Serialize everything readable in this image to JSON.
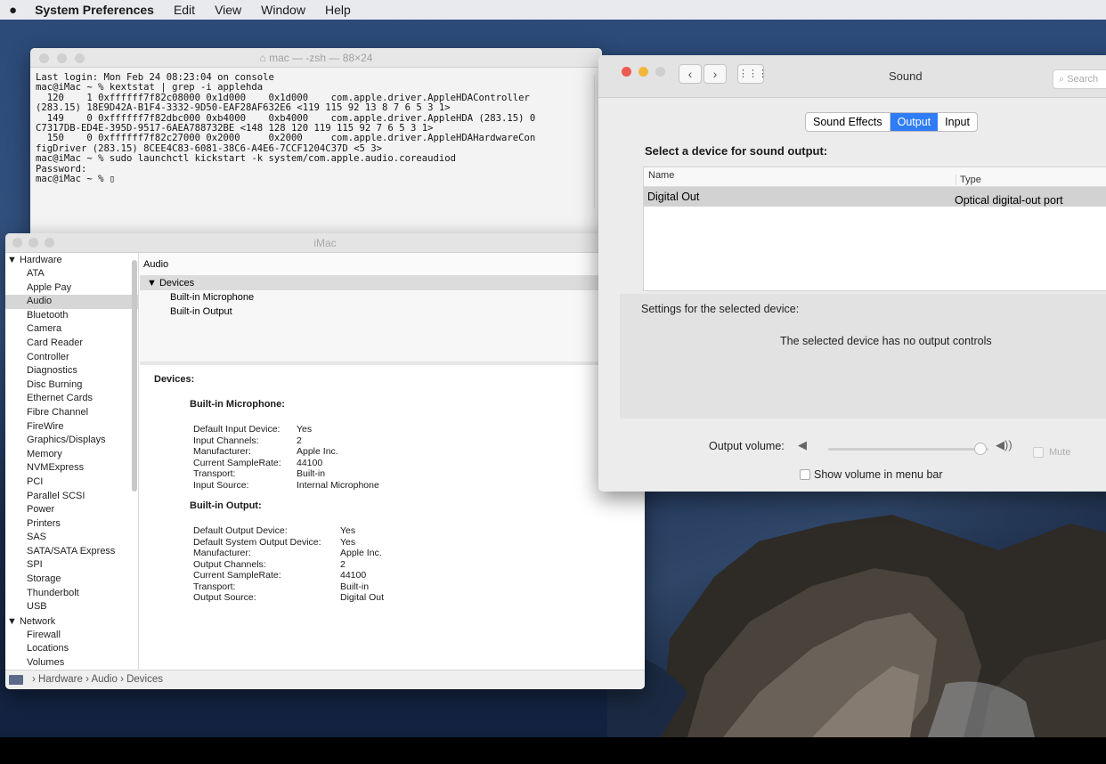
{
  "menubar": {
    "apple_icon": "apple-icon",
    "app": "System Preferences",
    "items": [
      "Edit",
      "View",
      "Window",
      "Help"
    ]
  },
  "terminal": {
    "title": "mac — -zsh — 88×24",
    "lines": [
      "Last login: Mon Feb 24 08:23:04 on console",
      "mac@iMac ~ % kextstat | grep -i applehda",
      "  120    1 0xffffff7f82c08000 0x1d000    0x1d000    com.apple.driver.AppleHDAController",
      "(283.15) 18E9D42A-B1F4-3332-9D50-EAF28AF632E6 <119 115 92 13 8 7 6 5 3 1>",
      "  149    0 0xffffff7f82dbc000 0xb4000    0xb4000    com.apple.driver.AppleHDA (283.15) 0",
      "C7317DB-ED4E-395D-9517-6AEA788732BE <148 128 120 119 115 92 7 6 5 3 1>",
      "  150    0 0xffffff7f82c27000 0x2000     0x2000     com.apple.driver.AppleHDAHardwareCon",
      "figDriver (283.15) 8CEE4C83-6081-38C6-A4E6-7CCF1204C37D <5 3>",
      "mac@iMac ~ % sudo launchctl kickstart -k system/com.apple.audio.coreaudiod",
      "Password:",
      "mac@iMac ~ % ▯"
    ]
  },
  "sysinfo": {
    "title": "iMac",
    "sidebar": [
      {
        "label": "▼ Hardware",
        "group": true
      },
      {
        "label": "ATA"
      },
      {
        "label": "Apple Pay"
      },
      {
        "label": "Audio",
        "selected": true
      },
      {
        "label": "Bluetooth"
      },
      {
        "label": "Camera"
      },
      {
        "label": "Card Reader"
      },
      {
        "label": "Controller"
      },
      {
        "label": "Diagnostics"
      },
      {
        "label": "Disc Burning"
      },
      {
        "label": "Ethernet Cards"
      },
      {
        "label": "Fibre Channel"
      },
      {
        "label": "FireWire"
      },
      {
        "label": "Graphics/Displays"
      },
      {
        "label": "Memory"
      },
      {
        "label": "NVMExpress"
      },
      {
        "label": "PCI"
      },
      {
        "label": "Parallel SCSI"
      },
      {
        "label": "Power"
      },
      {
        "label": "Printers"
      },
      {
        "label": "SAS"
      },
      {
        "label": "SATA/SATA Express"
      },
      {
        "label": "SPI"
      },
      {
        "label": "Storage"
      },
      {
        "label": "Thunderbolt"
      },
      {
        "label": "USB"
      },
      {
        "label": "▼ Network",
        "group": true
      },
      {
        "label": "Firewall"
      },
      {
        "label": "Locations"
      },
      {
        "label": "Volumes"
      }
    ],
    "list_header": "Audio",
    "devices_row": "▼ Devices",
    "device_items": [
      "Built-in Microphone",
      "Built-in Output"
    ],
    "detail_title": "Devices:",
    "mic": {
      "heading": "Built-in Microphone:",
      "keys": [
        "Default Input Device:",
        "Input Channels:",
        "Manufacturer:",
        "Current SampleRate:",
        "Transport:",
        "Input Source:"
      ],
      "values": [
        "Yes",
        "2",
        "Apple Inc.",
        "44100",
        "Built-in",
        "Internal Microphone"
      ]
    },
    "out": {
      "heading": "Built-in Output:",
      "keys": [
        "Default Output Device:",
        "Default System Output Device:",
        "Manufacturer:",
        "Output Channels:",
        "Current SampleRate:",
        "Transport:",
        "Output Source:"
      ],
      "values": [
        "Yes",
        "Yes",
        "Apple Inc.",
        "2",
        "44100",
        "Built-in",
        "Digital Out"
      ]
    },
    "path": "› Hardware › Audio › Devices"
  },
  "sound": {
    "title": "Sound",
    "search_placeholder": "Search",
    "tabs": [
      {
        "label": "Sound Effects"
      },
      {
        "label": "Output",
        "active": true
      },
      {
        "label": "Input"
      }
    ],
    "select_label": "Select a device for sound output:",
    "col_name": "Name",
    "col_type": "Type",
    "device_name": "Digital Out",
    "device_type": "Optical digital-out port",
    "settings_label": "Settings for the selected device:",
    "no_controls": "The selected device has no output controls",
    "volume_label": "Output volume:",
    "volume_level": 0.95,
    "mute_label": "Mute",
    "show_volume_label": "Show volume in menu bar"
  }
}
